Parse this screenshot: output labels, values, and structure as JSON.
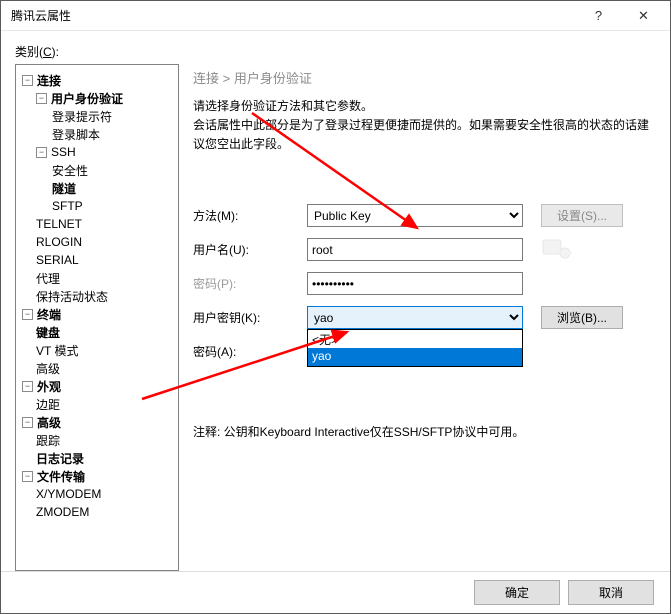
{
  "window": {
    "title": "腾讯云属性",
    "help_icon": "?",
    "close_icon": "✕"
  },
  "category_label_prefix": "类别(",
  "category_label_key": "C",
  "category_label_suffix": "):",
  "tree": {
    "connection": "连接",
    "auth": "用户身份验证",
    "login_prompt": "登录提示符",
    "login_script": "登录脚本",
    "ssh": "SSH",
    "security": "安全性",
    "tunnel": "隧道",
    "sftp": "SFTP",
    "telnet": "TELNET",
    "rlogin": "RLOGIN",
    "serial": "SERIAL",
    "proxy": "代理",
    "keepalive": "保持活动状态",
    "terminal": "终端",
    "keyboard": "键盘",
    "vt_mode": "VT 模式",
    "advanced_t": "高级",
    "appearance": "外观",
    "margin": "边距",
    "advanced_a": "高级",
    "trace": "跟踪",
    "logging": "日志记录",
    "file_transfer": "文件传输",
    "xymodem": "X/YMODEM",
    "zmodem": "ZMODEM"
  },
  "form": {
    "breadcrumb": "连接 > 用户身份验证",
    "desc1": "请选择身份验证方法和其它参数。",
    "desc2": "会话属性中此部分是为了登录过程更便捷而提供的。如果需要安全性很高的状态的话建议您空出此字段。",
    "method_label": "方法(M):",
    "method_value": "Public Key",
    "settings_btn": "设置(S)...",
    "username_label": "用户名(U):",
    "username_value": "root",
    "password_label": "密码(P):",
    "password_value": "●●●●●●●●●●",
    "userkey_label": "用户密钥(K):",
    "userkey_value": "yao",
    "browse_btn": "浏览(B)...",
    "passphrase_label": "密码(A):",
    "dropdown_none": "<无>",
    "dropdown_yao": "yao",
    "note": "注释: 公钥和Keyboard Interactive仅在SSH/SFTP协议中可用。"
  },
  "footer": {
    "ok": "确定",
    "cancel": "取消"
  }
}
